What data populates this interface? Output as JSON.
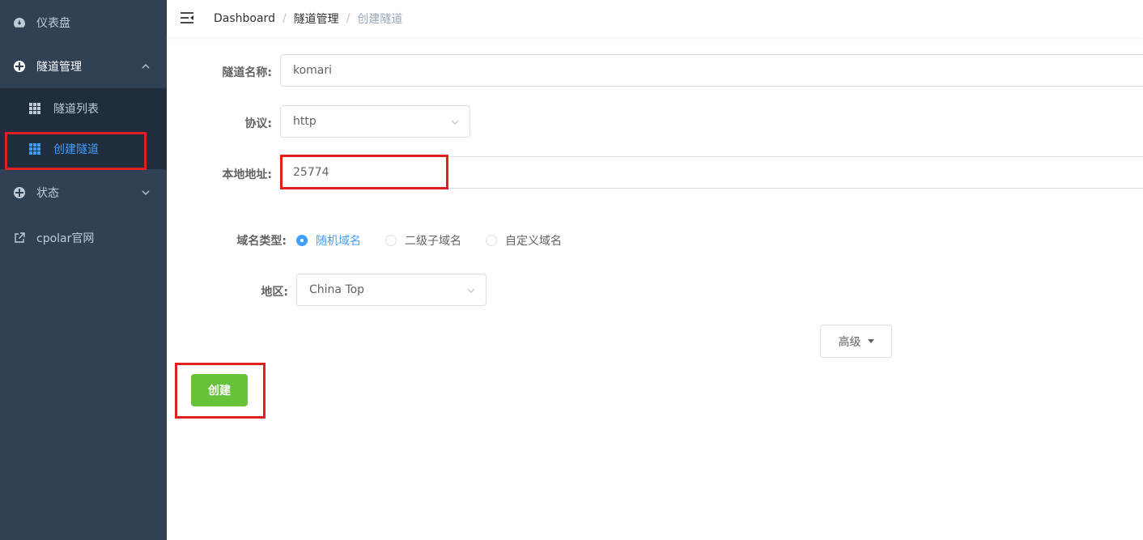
{
  "sidebar": {
    "dashboard": {
      "label": "仪表盘",
      "icon": "dashboard-icon"
    },
    "tunnel_mgmt": {
      "label": "隧道管理",
      "icon": "tunnel-icon"
    },
    "tunnel_list": {
      "label": "隧道列表",
      "icon": "grid-icon"
    },
    "create_tunnel": {
      "label": "创建隧道",
      "icon": "grid-icon"
    },
    "status": {
      "label": "状态",
      "icon": "status-icon"
    },
    "website": {
      "label": "cpolar官网",
      "icon": "external-link-icon"
    }
  },
  "breadcrumb": [
    "Dashboard",
    "隧道管理",
    "创建隧道"
  ],
  "form": {
    "name_label": "隧道名称:",
    "name_value": "komari",
    "protocol_label": "协议:",
    "protocol_value": "http",
    "local_addr_label": "本地地址:",
    "local_addr_value": "25774",
    "domain_type_label": "域名类型:",
    "domain_options": [
      "随机域名",
      "二级子域名",
      "自定义域名"
    ],
    "domain_selected": "随机域名",
    "region_label": "地区:",
    "region_value": "China Top",
    "advanced_label": "高级",
    "create_label": "创建"
  },
  "colors": {
    "sidebar_bg": "#304156",
    "submenu_bg": "#1f2d3d",
    "active_text": "#409eff",
    "primary": "#409eff",
    "success": "#67c23a",
    "highlight": "#e02020"
  }
}
